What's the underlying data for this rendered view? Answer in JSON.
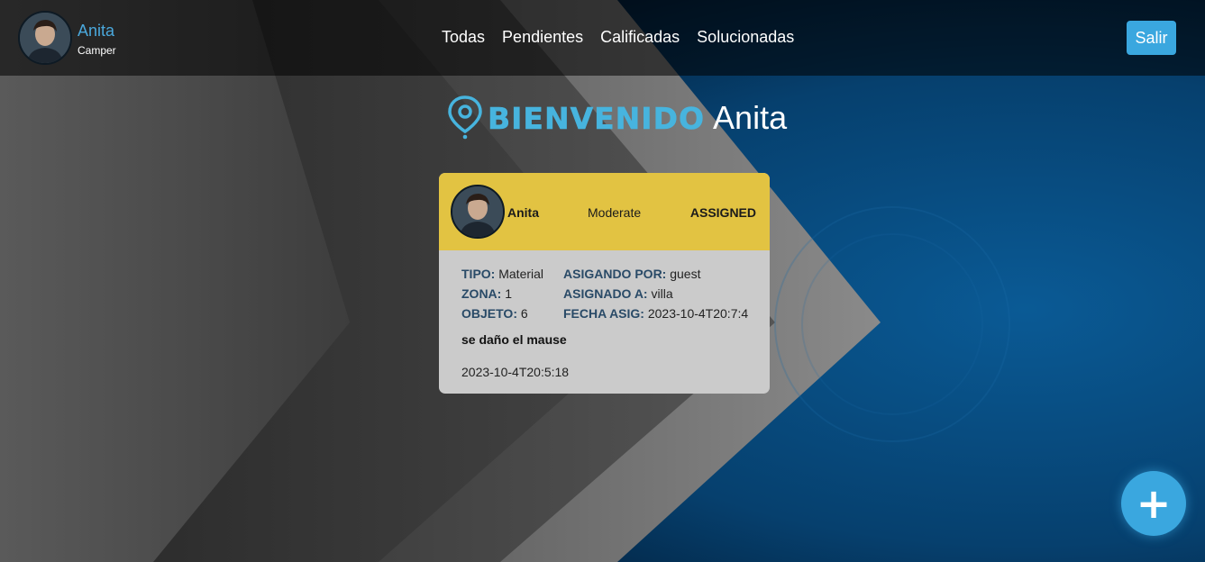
{
  "header": {
    "user_name": "Anita",
    "user_role": "Camper",
    "nav": [
      "Todas",
      "Pendientes",
      "Calificadas",
      "Solucionadas"
    ],
    "logout_label": "Salir"
  },
  "welcome": {
    "logo_word": "BIENVENIDO",
    "name": "Anita"
  },
  "card": {
    "name": "Anita",
    "priority": "Moderate",
    "status": "ASSIGNED",
    "fields": {
      "tipo_label": "TIPO:",
      "tipo_value": "Material",
      "asignando_label": "ASIGANDO POR:",
      "asignando_value": "guest",
      "zona_label": "ZONA:",
      "zona_value": "1",
      "asignado_label": "ASIGNADO A:",
      "asignado_value": "villa",
      "objeto_label": "OBJETO:",
      "objeto_value": "6",
      "fecha_label": "FECHA ASIG:",
      "fecha_value": "2023-10-4T20:7:4"
    },
    "description": "se daño el mause",
    "date": "2023-10-4T20:5:18"
  },
  "fab": {
    "icon": "plus-icon",
    "label": "+"
  },
  "colors": {
    "accent": "#3aa7df",
    "card_header": "#e2c342",
    "card_body": "#cbcbcb",
    "label_blue": "#294a67"
  }
}
